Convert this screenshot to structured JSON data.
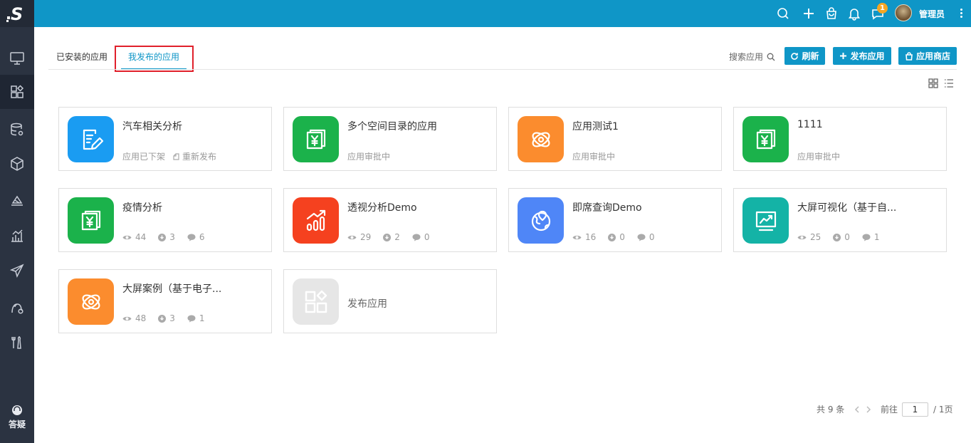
{
  "brand": {
    "logo_letter": "S"
  },
  "colors": {
    "topbar": "#0f96c7",
    "sidebar": "#2b3341",
    "accent": "#0f96c7",
    "highlight_border": "#e0202b",
    "badge": "#f5a623"
  },
  "sidebar": {
    "items": [
      {
        "icon": "monitor-icon"
      },
      {
        "icon": "apps-icon",
        "active": true
      },
      {
        "icon": "database-settings-icon"
      },
      {
        "icon": "cube-icon"
      },
      {
        "icon": "layers-icon"
      },
      {
        "icon": "bar-chart-icon"
      },
      {
        "icon": "send-icon"
      },
      {
        "icon": "user-settings-icon"
      },
      {
        "icon": "tools-icon"
      }
    ],
    "help_label": "答疑"
  },
  "topbar": {
    "icons": [
      "search-icon",
      "plus-icon",
      "bag-icon",
      "bell-icon",
      "message-icon"
    ],
    "message_badge": "1",
    "username": "管理员"
  },
  "tabs": [
    {
      "label": "已安装的应用"
    },
    {
      "label": "我发布的应用",
      "active": true
    }
  ],
  "toolbar": {
    "search_label": "搜索应用",
    "refresh_label": "刷新",
    "publish_label": "发布应用",
    "store_label": "应用商店"
  },
  "apps": [
    {
      "title": "汽车相关分析",
      "icon": "report-edit-icon",
      "color": "#1a9cf2",
      "status": "应用已下架",
      "republish_label": "重新发布"
    },
    {
      "title": "多个空间目录的应用",
      "icon": "yuan-document-icon",
      "color": "#1bb24b",
      "status": "应用审批中"
    },
    {
      "title": "应用测试1",
      "icon": "orbit-icon",
      "color": "#fb8c2e",
      "status": "应用审批中"
    },
    {
      "title": "1111",
      "icon": "yuan-document-icon",
      "color": "#1bb24b",
      "status": "应用审批中"
    },
    {
      "title": "疫情分析",
      "icon": "yuan-document-icon",
      "color": "#1bb24b",
      "views": "44",
      "downloads": "3",
      "comments": "6"
    },
    {
      "title": "透视分析Demo",
      "icon": "growth-chart-icon",
      "color": "#f5411f",
      "views": "29",
      "downloads": "2",
      "comments": "0"
    },
    {
      "title": "即席查询Demo",
      "icon": "globe-pin-icon",
      "color": "#4f86f7",
      "views": "16",
      "downloads": "0",
      "comments": "0"
    },
    {
      "title": "大屏可视化（基于自...",
      "icon": "trend-board-icon",
      "color": "#14b3a6",
      "views": "25",
      "downloads": "0",
      "comments": "1"
    },
    {
      "title": "大屏案例（基于电子...",
      "icon": "orbit-icon",
      "color": "#fb8c2e",
      "views": "48",
      "downloads": "3",
      "comments": "1"
    }
  ],
  "add_card": {
    "title": "发布应用",
    "icon": "apps-icon"
  },
  "pagination": {
    "total_label": "共 9 条",
    "goto_label": "前往",
    "current_page": "1",
    "total_pages_label": "/ 1页"
  }
}
